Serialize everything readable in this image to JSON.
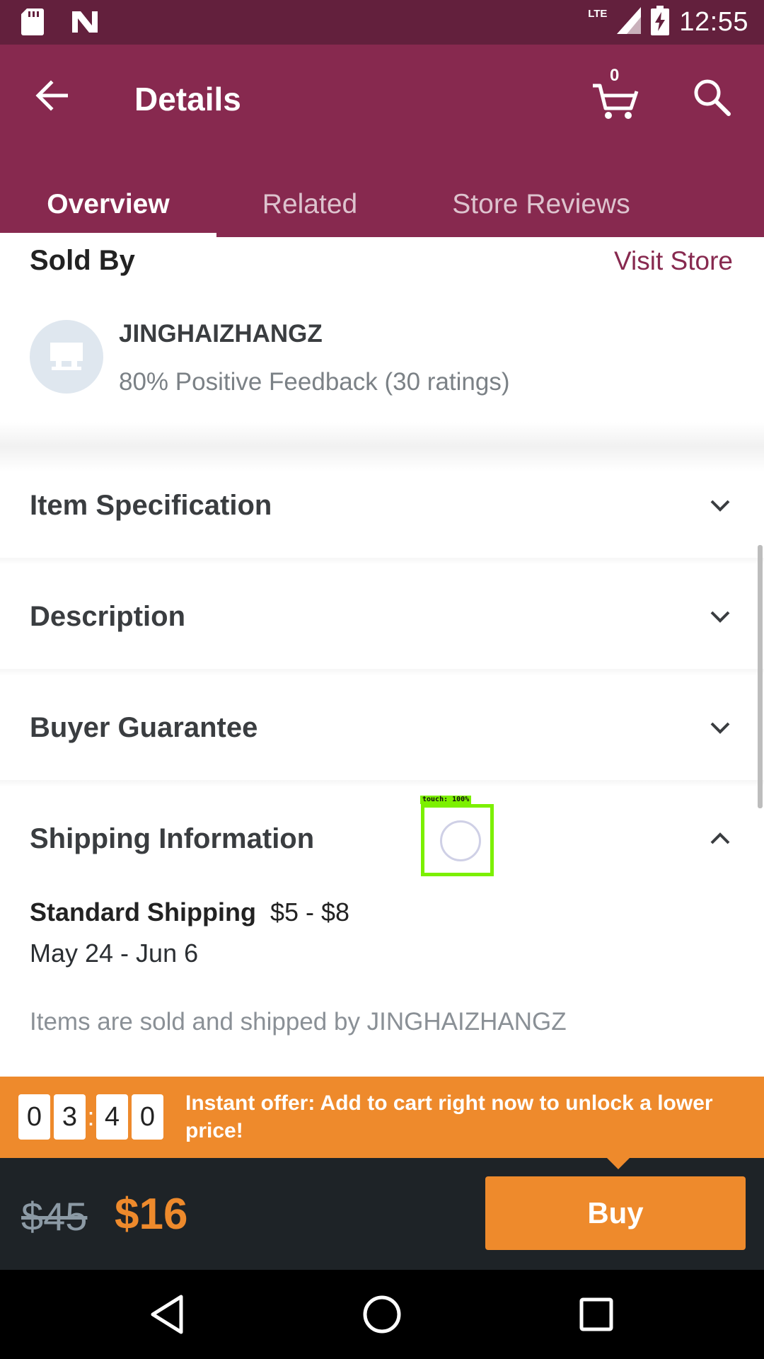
{
  "status_bar": {
    "time": "12:55",
    "network": "LTE",
    "icons": [
      "sd-card-icon",
      "n-logo-icon",
      "signal-icon",
      "battery-charging-icon"
    ]
  },
  "app_bar": {
    "title": "Details",
    "cart_count": "0",
    "icons": [
      "back-arrow-icon",
      "cart-icon",
      "search-icon"
    ]
  },
  "tabs": [
    {
      "label": "Overview",
      "active": true
    },
    {
      "label": "Related",
      "active": false
    },
    {
      "label": "Store Reviews",
      "active": false
    }
  ],
  "sold_by": {
    "title": "Sold By",
    "visit_store": "Visit Store",
    "store_name": "JINGHAIZHANGZ",
    "feedback": "80% Positive Feedback (30 ratings)"
  },
  "sections": [
    {
      "label": "Item Specification",
      "expanded": false
    },
    {
      "label": "Description",
      "expanded": false
    },
    {
      "label": "Buyer Guarantee",
      "expanded": false
    },
    {
      "label": "Shipping Information",
      "expanded": true
    }
  ],
  "shipping": {
    "method": "Standard Shipping",
    "price": "$5 - $8",
    "dates": "May 24 - Jun 6",
    "note": "Items are sold and shipped by JINGHAIZHANGZ"
  },
  "touch_indicator": {
    "label": "touch: 100%"
  },
  "offer": {
    "countdown_digits": [
      "0",
      "3",
      "4",
      "0"
    ],
    "separator": ":",
    "text": "Instant offer: Add to cart right now to unlock a lower price!"
  },
  "purchase": {
    "old_price": "$45",
    "new_price": "$16",
    "buy_label": "Buy"
  },
  "colors": {
    "status_bar": "#63203d",
    "app_bar": "#87294f",
    "accent_orange": "#ee8a2c",
    "buy_bar": "#1e2327"
  }
}
